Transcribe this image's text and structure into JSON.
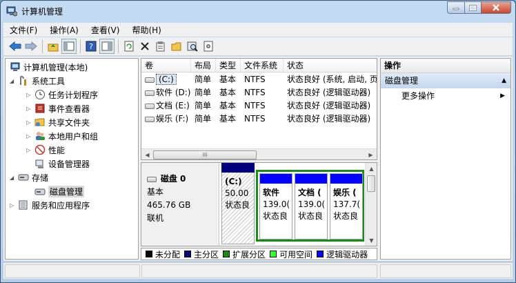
{
  "window": {
    "title": "计算机管理"
  },
  "menu": [
    "文件(F)",
    "操作(A)",
    "查看(V)",
    "帮助(H)"
  ],
  "toolbar": [
    "back-icon",
    "forward-icon",
    "up-folder-icon",
    "show-tree-icon",
    "help-icon",
    "panel-icon",
    "refresh-icon",
    "delete-icon",
    "properties-icon",
    "open-icon",
    "search-disk-icon",
    "settings-icon"
  ],
  "tree": {
    "root": "计算机管理(本地)",
    "system_tools": "系统工具",
    "task_scheduler": "任务计划程序",
    "event_viewer": "事件查看器",
    "shared_folders": "共享文件夹",
    "local_users": "本地用户和组",
    "performance": "性能",
    "device_manager": "设备管理器",
    "storage": "存储",
    "disk_management": "磁盘管理",
    "services": "服务和应用程序"
  },
  "volumes": {
    "headers": [
      "卷",
      "布局",
      "类型",
      "文件系统",
      "状态"
    ],
    "rows": [
      {
        "name": "(C:)",
        "layout": "简单",
        "type": "基本",
        "fs": "NTFS",
        "status": "状态良好 (系统, 启动, 页"
      },
      {
        "name": "软件 (D:)",
        "layout": "简单",
        "type": "基本",
        "fs": "NTFS",
        "status": "状态良好 (逻辑驱动器)"
      },
      {
        "name": "文档 (E:)",
        "layout": "简单",
        "type": "基本",
        "fs": "NTFS",
        "status": "状态良好 (逻辑驱动器)"
      },
      {
        "name": "娱乐 (F:)",
        "layout": "简单",
        "type": "基本",
        "fs": "NTFS",
        "status": "状态良好 (逻辑驱动器)"
      }
    ],
    "scroll_thumb": "III"
  },
  "disk": {
    "name": "磁盘 0",
    "kind": "基本",
    "size": "465.76 GB",
    "state": "联机",
    "partitions": [
      {
        "label": "(C:)",
        "size": "50.00",
        "status": "状态良"
      },
      {
        "label": "软件",
        "size": "139.0(",
        "status": "状态良"
      },
      {
        "label": "文档 (",
        "size": "139.0(",
        "status": "状态良"
      },
      {
        "label": "娱乐 (",
        "size": "137.7(",
        "status": "状态良"
      }
    ]
  },
  "legend": [
    {
      "label": "未分配",
      "color": "#000000"
    },
    {
      "label": "主分区",
      "color": "#00007f"
    },
    {
      "label": "扩展分区",
      "color": "#1a8a1a"
    },
    {
      "label": "可用空间",
      "color": "#33ff33"
    },
    {
      "label": "逻辑驱动器",
      "color": "#0000ff"
    }
  ],
  "actions": {
    "header": "操作",
    "section": "磁盘管理",
    "more": "更多操作"
  }
}
